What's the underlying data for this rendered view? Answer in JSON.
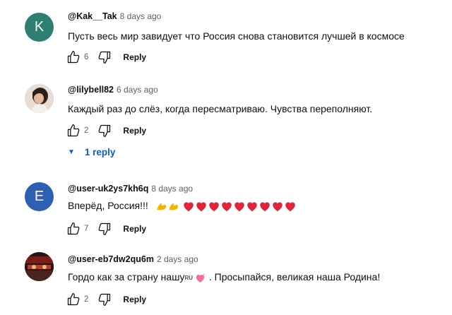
{
  "comments": [
    {
      "avatar_letter": "K",
      "avatar_color": "#2c7f71",
      "handle": "@Kak__Tak",
      "time": "8 days ago",
      "text": "Пусть весь мир завидует что Россия снова становится лучшей в  космосе",
      "likes": "6",
      "reply_label": "Reply"
    },
    {
      "avatar_letter": "",
      "avatar_color": "#c9b7a8",
      "handle": "@lilybell82",
      "time": "6 days ago",
      "text": "Каждый раз до слёз, когда пересматриваю. Чувства переполняют.",
      "likes": "2",
      "reply_label": "Reply",
      "replies_label": "1 reply"
    },
    {
      "avatar_letter": "E",
      "avatar_color": "#2f5fb3",
      "handle": "@user-uk2ys7kh6q",
      "time": "8 days ago",
      "text": "Вперёд, Россия!!!",
      "likes": "7",
      "reply_label": "Reply"
    },
    {
      "avatar_letter": "",
      "avatar_color": "#3a1d1a",
      "handle": "@user-eb7dw2qu6m",
      "time": "2 days ago",
      "text_before": "Гордо как за страну нашу",
      "flag_text": "RU",
      "text_after": " . Просыпайся, великая наша Родина!",
      "likes": "2",
      "reply_label": "Reply"
    }
  ],
  "icons": {
    "like": "thumb-up-icon",
    "dislike": "thumb-down-icon",
    "heart": "red-heart-icon",
    "muscle": "flexed-biceps-icon",
    "sparkle_heart": "sparkling-heart-icon"
  }
}
